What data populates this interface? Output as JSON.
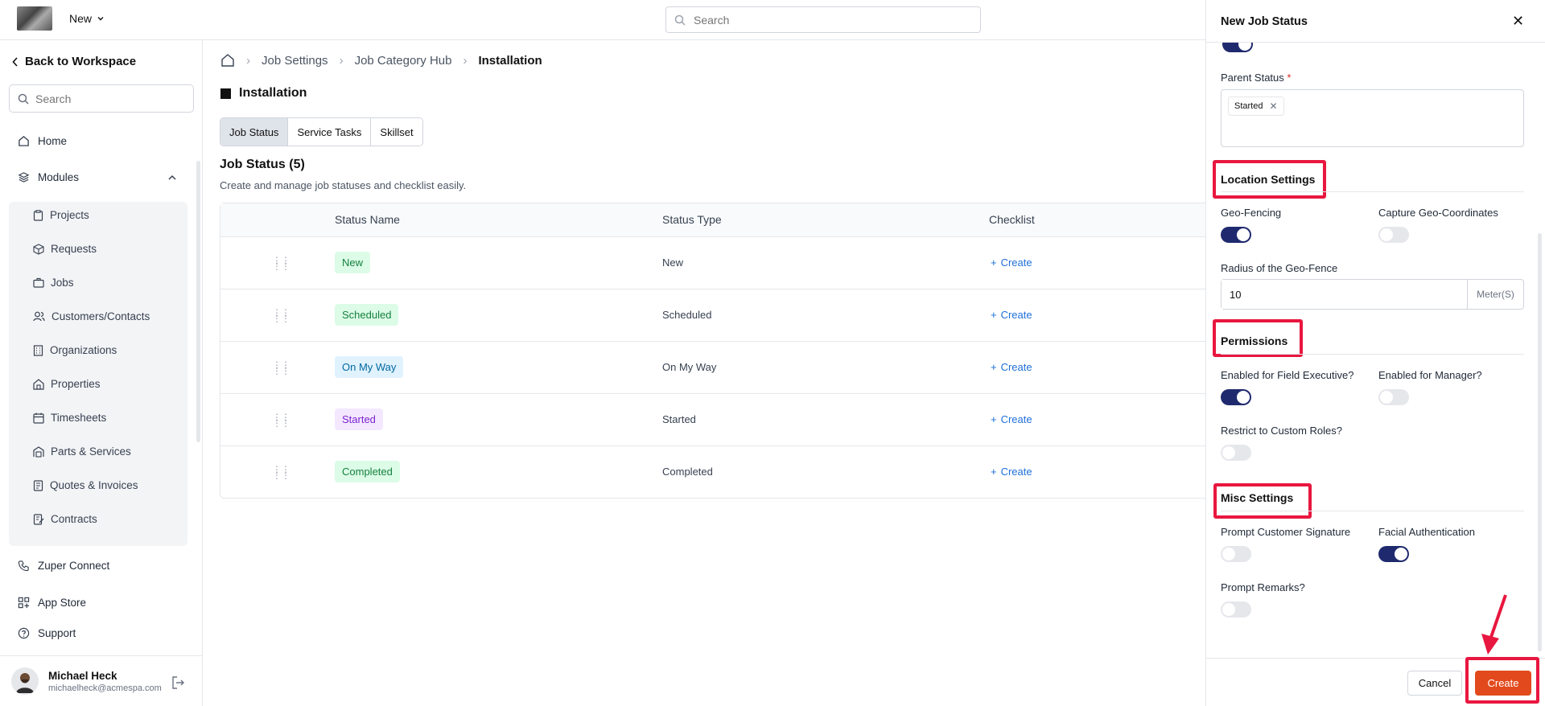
{
  "header": {
    "new_label": "New",
    "search_placeholder": "Search"
  },
  "sidebar": {
    "back_label": "Back to Workspace",
    "search_placeholder": "Search",
    "home": "Home",
    "modules": "Modules",
    "module_items": [
      "Projects",
      "Requests",
      "Jobs",
      "Customers/Contacts",
      "Organizations",
      "Properties",
      "Timesheets",
      "Parts & Services",
      "Quotes & Invoices",
      "Contracts"
    ],
    "zuper_connect": "Zuper Connect",
    "app_store": "App Store",
    "support": "Support",
    "user": {
      "name": "Michael Heck",
      "email": "michaelheck@acmespa.com"
    }
  },
  "breadcrumb": [
    "Job Settings",
    "Job Category Hub",
    "Installation"
  ],
  "page_title": "Installation",
  "tabs": [
    "Job Status",
    "Service Tasks",
    "Skillset"
  ],
  "section": {
    "title": "Job Status (5)",
    "subtitle": "Create and manage job statuses and checklist easily."
  },
  "table": {
    "columns": [
      "Status Name",
      "Status Type",
      "Checklist"
    ],
    "rows": [
      {
        "name": "New",
        "type": "New",
        "checklist": "Create",
        "bg": "#dcfce7",
        "fg": "#15803d"
      },
      {
        "name": "Scheduled",
        "type": "Scheduled",
        "checklist": "Create",
        "bg": "#dcfce7",
        "fg": "#15803d"
      },
      {
        "name": "On My Way",
        "type": "On My Way",
        "checklist": "Create",
        "bg": "#e0f2fe",
        "fg": "#0369a1"
      },
      {
        "name": "Started",
        "type": "Started",
        "checklist": "Create",
        "bg": "#f3e8ff",
        "fg": "#7e22ce"
      },
      {
        "name": "Completed",
        "type": "Completed",
        "checklist": "Create",
        "bg": "#dcfce7",
        "fg": "#15803d"
      }
    ]
  },
  "panel": {
    "title": "New Job Status",
    "parent_status_label": "Parent Status",
    "parent_status_chip": "Started",
    "location_settings": "Location Settings",
    "geo_fencing": "Geo-Fencing",
    "geo_fencing_on": true,
    "capture_geo": "Capture Geo-Coordinates",
    "capture_geo_on": false,
    "radius_label": "Radius of the Geo-Fence",
    "radius_value": "10",
    "radius_unit": "Meter(S)",
    "permissions": "Permissions",
    "field_exec": "Enabled for Field Executive?",
    "field_exec_on": true,
    "manager": "Enabled for Manager?",
    "manager_on": false,
    "custom_roles": "Restrict to Custom Roles?",
    "custom_roles_on": false,
    "misc_settings": "Misc Settings",
    "customer_signature": "Prompt Customer Signature",
    "customer_signature_on": false,
    "facial_auth": "Facial Authentication",
    "facial_auth_on": true,
    "remarks": "Prompt Remarks?",
    "remarks_on": false,
    "cancel": "Cancel",
    "create": "Create"
  },
  "colors": {
    "accent_dark": "#1f2a6e",
    "create_button": "#e24a1d",
    "highlight": "#e8173f",
    "link": "#1e6fd9"
  }
}
